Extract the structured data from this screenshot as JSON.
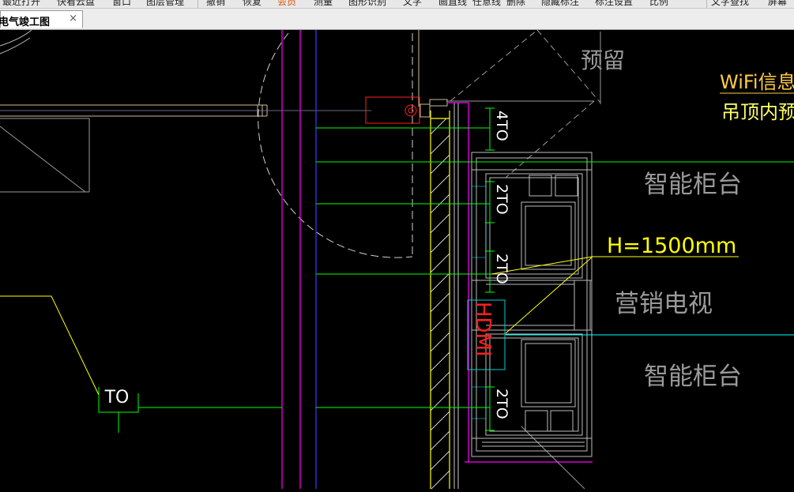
{
  "toolbar": {
    "items": [
      {
        "label": "最近打开",
        "active": false
      },
      {
        "label": "快看云盘",
        "active": false
      },
      {
        "label": "窗口",
        "active": false
      },
      {
        "label": "图层管理",
        "active": false
      },
      {
        "label": "撤销",
        "active": false
      },
      {
        "label": "恢复",
        "active": false
      },
      {
        "label": "会员",
        "active": true
      },
      {
        "label": "测量",
        "active": false
      },
      {
        "label": "图形识别",
        "active": false
      },
      {
        "label": "文字",
        "active": false
      },
      {
        "label": "画直线",
        "active": false
      },
      {
        "label": "任意线",
        "active": false
      },
      {
        "label": "删除",
        "active": false
      },
      {
        "label": "隐藏标注",
        "active": false
      },
      {
        "label": "标注设置",
        "active": false
      },
      {
        "label": "比例",
        "active": false
      },
      {
        "label": "文字查找",
        "active": false
      },
      {
        "label": "屏幕",
        "active": false
      }
    ]
  },
  "tab": {
    "title": "电气竣工图",
    "close_glyph": "×"
  },
  "drawing": {
    "colors": {
      "background": "#000000",
      "white": "#ffffff",
      "green": "#00ff00",
      "yellow": "#ffff00",
      "magenta": "#ff00ff",
      "blue": "#3a3aff",
      "cyan": "#00ffff",
      "red": "#ff2020",
      "gray": "#9a9a9a",
      "orange": "#ffcc66"
    },
    "labels": {
      "reserve": "预留",
      "wifi": "WiFi信息",
      "ceiling": "吊顶内预留",
      "smart_cabinet_top": "智能柜台",
      "height": "H=1500mm",
      "marketing_tv": "营销电视",
      "smart_cabinet_bottom": "智能柜台",
      "hdmi": "HDMI",
      "socket_4to": "4TO",
      "socket_2to_a": "2TO",
      "socket_2to_b": "2TO",
      "socket_2to_c": "2TO",
      "socket_to": "TO"
    }
  }
}
